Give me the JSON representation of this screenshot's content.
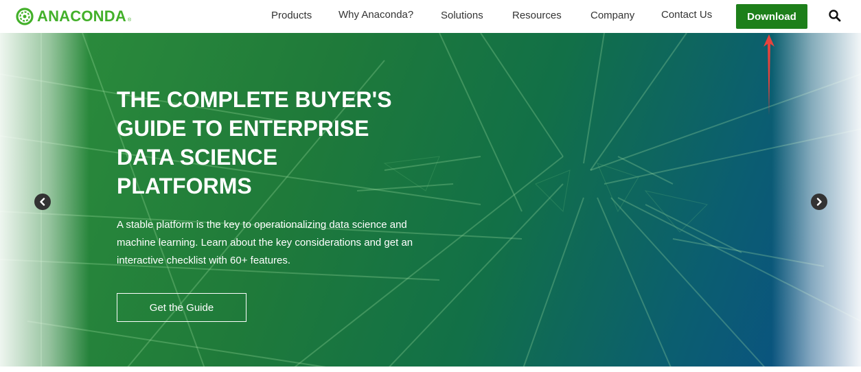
{
  "header": {
    "logo_text": "ANACONDA",
    "logo_reg": "®",
    "nav_items": [
      {
        "label": "Products"
      },
      {
        "label": "Why Anaconda?"
      },
      {
        "label": "Solutions"
      },
      {
        "label": "Resources"
      },
      {
        "label": "Company"
      },
      {
        "label": "Contact Us"
      }
    ],
    "download_label": "Download",
    "search_icon": "search-icon"
  },
  "hero": {
    "title": "THE COMPLETE BUYER'S\nGUIDE TO ENTERPRISE\nDATA SCIENCE\nPLATFORMS",
    "description": "A stable platform is the key to operationalizing data science and machine learning. Learn about the key considerations and get an interactive checklist with 60+ features.",
    "cta_label": "Get the Guide",
    "prev_icon": "chevron-left-icon",
    "next_icon": "chevron-right-icon"
  },
  "annotation": {
    "icon": "arrow-up-icon",
    "color": "#e8433d"
  },
  "colors": {
    "brand_green": "#43b02a",
    "download_green": "#1d7f1a",
    "hero_green": "#2e8f3c",
    "hero_blue": "#0a4c8a"
  }
}
